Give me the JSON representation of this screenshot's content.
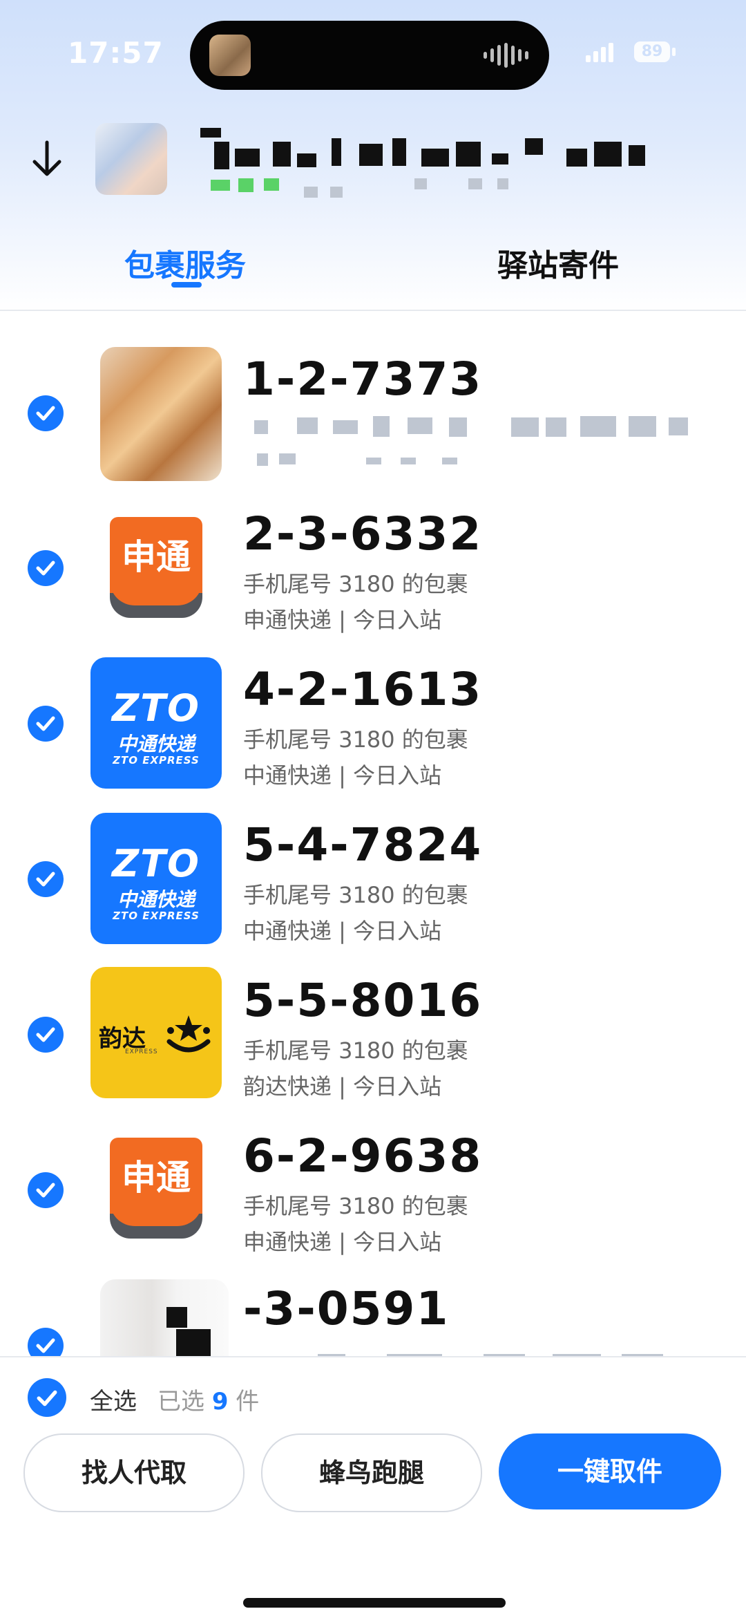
{
  "status_bar": {
    "time": "17:57",
    "battery": "89"
  },
  "tabs": [
    {
      "label": "包裹服务",
      "active": true
    },
    {
      "label": "驿站寄件",
      "active": false
    }
  ],
  "packages": [
    {
      "code": "1-2-7373",
      "logo": "blurred-image"
    },
    {
      "code": "2-3-6332",
      "logo": "sto-logo",
      "logo_text": "申通",
      "line1": "手机尾号 3180 的包裹",
      "line2": "申通快递 | 今日入站"
    },
    {
      "code": "4-2-1613",
      "logo": "zto-logo",
      "logo_text": "ZTO",
      "logo_cn": "中通快递",
      "logo_en": "ZTO EXPRESS",
      "line1": "手机尾号 3180 的包裹",
      "line2": "中通快递 | 今日入站"
    },
    {
      "code": "5-4-7824",
      "logo": "zto-logo",
      "logo_text": "ZTO",
      "logo_cn": "中通快递",
      "logo_en": "ZTO EXPRESS",
      "line1": "手机尾号 3180 的包裹",
      "line2": "中通快递 | 今日入站"
    },
    {
      "code": "5-5-8016",
      "logo": "yunda-logo",
      "logo_text": "韵达",
      "logo_en": "EXPRESS",
      "line1": "手机尾号 3180 的包裹",
      "line2": "韵达快递 | 今日入站"
    },
    {
      "code": "6-2-9638",
      "logo": "sto-logo",
      "logo_text": "申通",
      "line1": "手机尾号 3180 的包裹",
      "line2": "申通快递 | 今日入站"
    },
    {
      "code": "-3-0591",
      "logo": "blurred-image"
    }
  ],
  "footer": {
    "select_all": "全选",
    "selected_prefix": "已选",
    "selected_count": "9",
    "selected_suffix": "件",
    "buttons": {
      "find_person": "找人代取",
      "fengniao": "蜂鸟跑腿",
      "one_click": "一键取件"
    }
  },
  "colors": {
    "accent": "#1677ff",
    "sto": "#f26b22",
    "yunda": "#f5c518"
  }
}
